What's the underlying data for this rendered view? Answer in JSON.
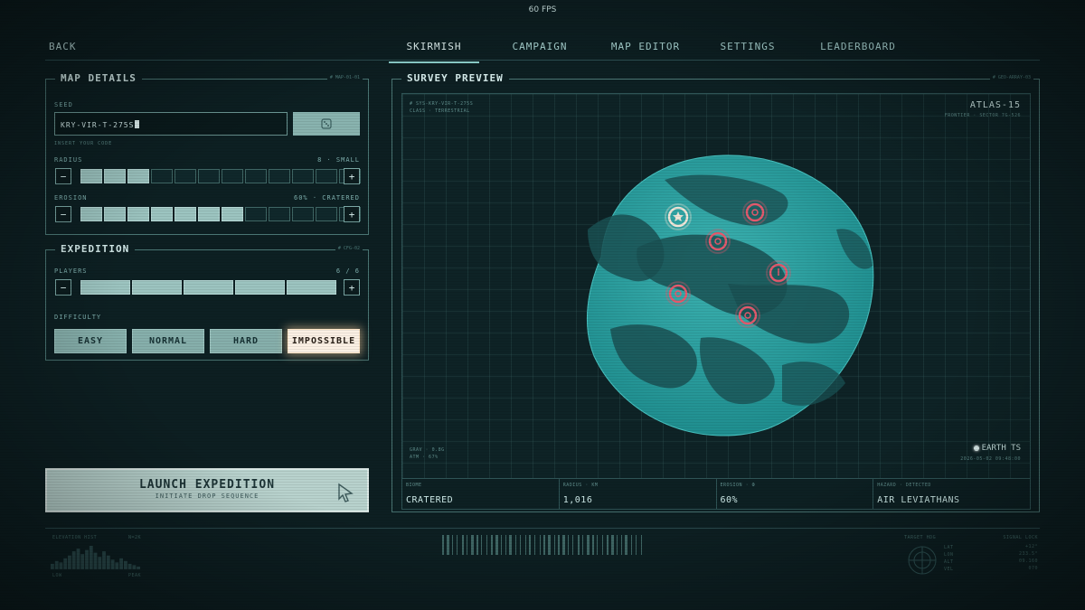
{
  "fps": "60 FPS",
  "nav": {
    "back": "BACK",
    "tabs": [
      "SKIRMISH",
      "CAMPAIGN",
      "MAP EDITOR",
      "SETTINGS",
      "LEADERBOARD"
    ]
  },
  "map_details": {
    "title": "MAP DETAILS",
    "code": "# MAP-01-01",
    "seed_label": "SEED",
    "seed_value": "KRY-VIR-T-275S",
    "seed_hint": "INSERT YOUR CODE",
    "radius_label": "RADIUS",
    "radius_value": "8 · SMALL",
    "radius_level": 3,
    "radius_total": 12,
    "erosion_label": "EROSION",
    "erosion_value": "60% · CRATERED",
    "erosion_level": 7,
    "erosion_total": 12
  },
  "expedition": {
    "title": "EXPEDITION",
    "code": "# CFG-02",
    "players_label": "PLAYERS",
    "players_value": "6 / 6",
    "players_count": 5,
    "difficulty_label": "DIFFICULTY",
    "difficulties": [
      "EASY",
      "NORMAL",
      "HARD",
      "IMPOSSIBLE"
    ],
    "selected_difficulty": "IMPOSSIBLE"
  },
  "launch": {
    "label": "LAUNCH EXPEDITION",
    "sub": "INITIATE DROP SEQUENCE"
  },
  "preview": {
    "title": "SURVEY PREVIEW",
    "code": "# GEO-ARRAY-03",
    "sys_id": "# SYS-KRY-VIR-T-275S",
    "sys_class": "CLASS · TERRESTRIAL",
    "planet_name": "ATLAS-15",
    "planet_sub": "FRONTIER · SECTOR 7G-526",
    "grav": "GRAV · 0.8g",
    "atm": "ATM · 67%",
    "clock_label": "EARTH TS",
    "clock_time": "2026-05-02 09:48:00",
    "stats": [
      {
        "k": "BIOME",
        "v": "CRATERED"
      },
      {
        "k": "RADIUS · KM",
        "v": "1,016"
      },
      {
        "k": "EROSION · Ф",
        "v": "60%"
      },
      {
        "k": "HAZARD · DETECTED",
        "v": "AIR LEVIATHANS"
      }
    ]
  },
  "footer": {
    "elev_label": "ELEVATION HIST",
    "elev_code": "N=2K",
    "elev_low": "LOW",
    "elev_peak": "PEAK",
    "elev_bars": [
      8,
      12,
      10,
      16,
      20,
      26,
      30,
      22,
      28,
      34,
      24,
      18,
      26,
      20,
      14,
      10,
      16,
      12,
      8,
      6,
      4
    ],
    "heading_label": "TARGET HDG",
    "compass_vals": [
      "LAT",
      "LON",
      "ALT",
      "VEL"
    ],
    "signal_label": "SIGNAL LOCK",
    "signal_vals": [
      "+12°",
      "233.5°",
      "09.160",
      "070"
    ]
  },
  "colors": {
    "bg": "#0d1f22",
    "accent": "#8fd3cf",
    "planet": "#2fa3a3",
    "marker": "#e35a6d",
    "highlight": "#fbf0e4"
  }
}
